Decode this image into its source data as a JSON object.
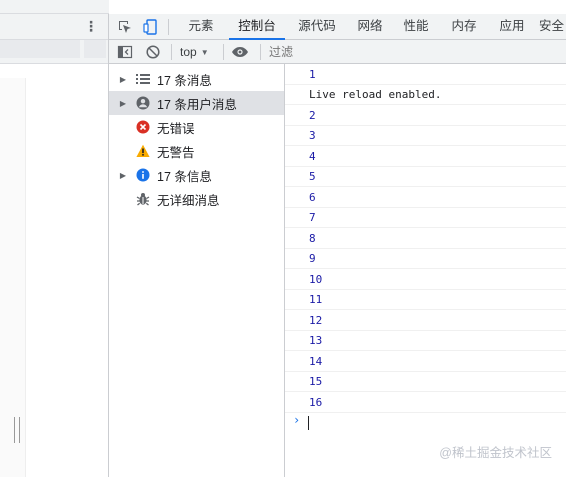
{
  "tabs": [
    {
      "label": "元素"
    },
    {
      "label": "控制台"
    },
    {
      "label": "源代码"
    },
    {
      "label": "网络"
    },
    {
      "label": "性能"
    },
    {
      "label": "内存"
    },
    {
      "label": "应用"
    },
    {
      "label": "安全"
    }
  ],
  "active_tab": "控制台",
  "toolbar": {
    "context": "top",
    "filter_placeholder": "过滤"
  },
  "sidebar": {
    "items": [
      {
        "label": "17 条消息",
        "icon": "list-icon",
        "expandable": true
      },
      {
        "label": "17 条用户消息",
        "icon": "user-icon",
        "expandable": true,
        "selected": true
      },
      {
        "label": "无错误",
        "icon": "error-icon",
        "expandable": false
      },
      {
        "label": "无警告",
        "icon": "warning-icon",
        "expandable": false
      },
      {
        "label": "17 条信息",
        "icon": "info-icon",
        "expandable": true
      },
      {
        "label": "无详细消息",
        "icon": "bug-icon",
        "expandable": false
      }
    ]
  },
  "console": {
    "messages": [
      "1",
      "Live reload enabled.",
      "2",
      "3",
      "4",
      "5",
      "6",
      "7",
      "8",
      "9",
      "10",
      "11",
      "12",
      "13",
      "14",
      "15",
      "16"
    ],
    "prompt_symbol": "›"
  },
  "watermark": "@稀土掘金技术社区",
  "colors": {
    "accent": "#1a73e8",
    "error": "#d93025",
    "warning": "#f9ab00",
    "info": "#1a73e8",
    "number": "#1a1aa6"
  }
}
